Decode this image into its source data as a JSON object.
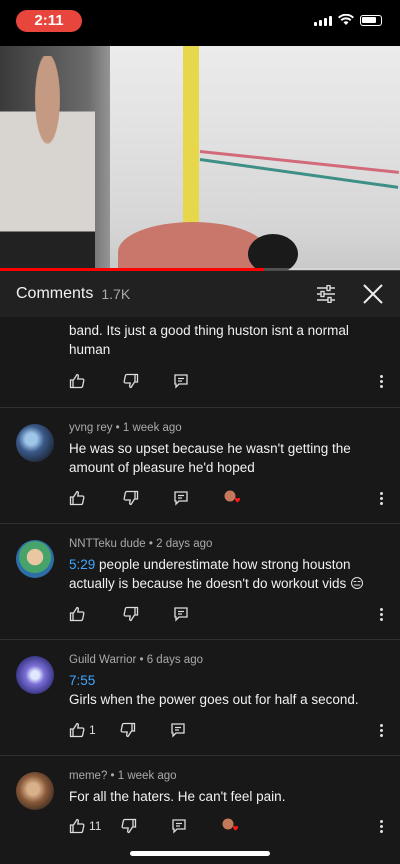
{
  "status": {
    "time": "2:11"
  },
  "video": {
    "progress_fraction": 0.66
  },
  "comments_header": {
    "title": "Comments",
    "count": "1.7K"
  },
  "comments": [
    {
      "author_line": "",
      "text_plain": "band. Its just a good thing huston isnt a normal human",
      "like_count": "",
      "has_creator_heart": false
    },
    {
      "author_line": "yvng rey • 1 week ago",
      "text_plain": "He was so upset because he wasn't getting the amount of pleasure he'd hoped",
      "like_count": "",
      "has_creator_heart": true
    },
    {
      "author_line": "NNTTeku dude • 2 days ago",
      "timestamp": "5:29",
      "text_after_ts": "people underestimate how strong houston actually is because he doesn't do workout vids 😑",
      "like_count": "",
      "has_creator_heart": false
    },
    {
      "author_line": "Guild Warrior • 6 days ago",
      "timestamp": "7:55",
      "text_plain": "Girls when the power goes out for half a second.",
      "like_count": "1",
      "has_creator_heart": false
    },
    {
      "author_line": "meme? • 1 week ago",
      "text_plain": "For all the haters. He can't feel pain.",
      "like_count": "11",
      "has_creator_heart": true
    }
  ],
  "colors": {
    "accent": "#3ea6ff",
    "progress": "#ff0000",
    "status_pill": "#e8453c"
  },
  "icons": [
    "filter-icon",
    "close-icon",
    "thumb-up-icon",
    "thumb-down-icon",
    "reply-icon",
    "more-vert-icon",
    "creator-heart-icon"
  ]
}
